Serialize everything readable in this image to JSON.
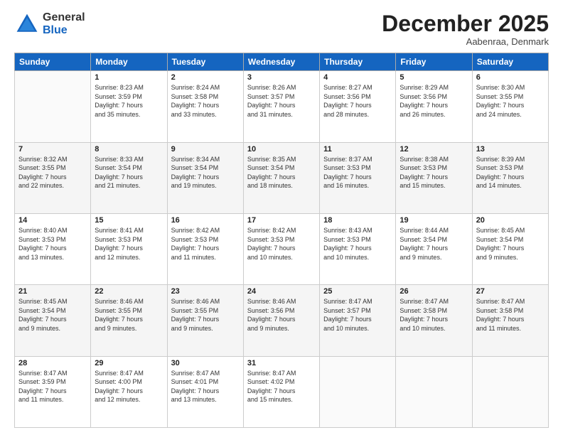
{
  "header": {
    "logo_general": "General",
    "logo_blue": "Blue",
    "month_title": "December 2025",
    "location": "Aabenraa, Denmark"
  },
  "days_of_week": [
    "Sunday",
    "Monday",
    "Tuesday",
    "Wednesday",
    "Thursday",
    "Friday",
    "Saturday"
  ],
  "weeks": [
    [
      {
        "day": "",
        "info": ""
      },
      {
        "day": "1",
        "info": "Sunrise: 8:23 AM\nSunset: 3:59 PM\nDaylight: 7 hours\nand 35 minutes."
      },
      {
        "day": "2",
        "info": "Sunrise: 8:24 AM\nSunset: 3:58 PM\nDaylight: 7 hours\nand 33 minutes."
      },
      {
        "day": "3",
        "info": "Sunrise: 8:26 AM\nSunset: 3:57 PM\nDaylight: 7 hours\nand 31 minutes."
      },
      {
        "day": "4",
        "info": "Sunrise: 8:27 AM\nSunset: 3:56 PM\nDaylight: 7 hours\nand 28 minutes."
      },
      {
        "day": "5",
        "info": "Sunrise: 8:29 AM\nSunset: 3:56 PM\nDaylight: 7 hours\nand 26 minutes."
      },
      {
        "day": "6",
        "info": "Sunrise: 8:30 AM\nSunset: 3:55 PM\nDaylight: 7 hours\nand 24 minutes."
      }
    ],
    [
      {
        "day": "7",
        "info": "Sunrise: 8:32 AM\nSunset: 3:55 PM\nDaylight: 7 hours\nand 22 minutes."
      },
      {
        "day": "8",
        "info": "Sunrise: 8:33 AM\nSunset: 3:54 PM\nDaylight: 7 hours\nand 21 minutes."
      },
      {
        "day": "9",
        "info": "Sunrise: 8:34 AM\nSunset: 3:54 PM\nDaylight: 7 hours\nand 19 minutes."
      },
      {
        "day": "10",
        "info": "Sunrise: 8:35 AM\nSunset: 3:54 PM\nDaylight: 7 hours\nand 18 minutes."
      },
      {
        "day": "11",
        "info": "Sunrise: 8:37 AM\nSunset: 3:53 PM\nDaylight: 7 hours\nand 16 minutes."
      },
      {
        "day": "12",
        "info": "Sunrise: 8:38 AM\nSunset: 3:53 PM\nDaylight: 7 hours\nand 15 minutes."
      },
      {
        "day": "13",
        "info": "Sunrise: 8:39 AM\nSunset: 3:53 PM\nDaylight: 7 hours\nand 14 minutes."
      }
    ],
    [
      {
        "day": "14",
        "info": "Sunrise: 8:40 AM\nSunset: 3:53 PM\nDaylight: 7 hours\nand 13 minutes."
      },
      {
        "day": "15",
        "info": "Sunrise: 8:41 AM\nSunset: 3:53 PM\nDaylight: 7 hours\nand 12 minutes."
      },
      {
        "day": "16",
        "info": "Sunrise: 8:42 AM\nSunset: 3:53 PM\nDaylight: 7 hours\nand 11 minutes."
      },
      {
        "day": "17",
        "info": "Sunrise: 8:42 AM\nSunset: 3:53 PM\nDaylight: 7 hours\nand 10 minutes."
      },
      {
        "day": "18",
        "info": "Sunrise: 8:43 AM\nSunset: 3:53 PM\nDaylight: 7 hours\nand 10 minutes."
      },
      {
        "day": "19",
        "info": "Sunrise: 8:44 AM\nSunset: 3:54 PM\nDaylight: 7 hours\nand 9 minutes."
      },
      {
        "day": "20",
        "info": "Sunrise: 8:45 AM\nSunset: 3:54 PM\nDaylight: 7 hours\nand 9 minutes."
      }
    ],
    [
      {
        "day": "21",
        "info": "Sunrise: 8:45 AM\nSunset: 3:54 PM\nDaylight: 7 hours\nand 9 minutes."
      },
      {
        "day": "22",
        "info": "Sunrise: 8:46 AM\nSunset: 3:55 PM\nDaylight: 7 hours\nand 9 minutes."
      },
      {
        "day": "23",
        "info": "Sunrise: 8:46 AM\nSunset: 3:55 PM\nDaylight: 7 hours\nand 9 minutes."
      },
      {
        "day": "24",
        "info": "Sunrise: 8:46 AM\nSunset: 3:56 PM\nDaylight: 7 hours\nand 9 minutes."
      },
      {
        "day": "25",
        "info": "Sunrise: 8:47 AM\nSunset: 3:57 PM\nDaylight: 7 hours\nand 10 minutes."
      },
      {
        "day": "26",
        "info": "Sunrise: 8:47 AM\nSunset: 3:58 PM\nDaylight: 7 hours\nand 10 minutes."
      },
      {
        "day": "27",
        "info": "Sunrise: 8:47 AM\nSunset: 3:58 PM\nDaylight: 7 hours\nand 11 minutes."
      }
    ],
    [
      {
        "day": "28",
        "info": "Sunrise: 8:47 AM\nSunset: 3:59 PM\nDaylight: 7 hours\nand 11 minutes."
      },
      {
        "day": "29",
        "info": "Sunrise: 8:47 AM\nSunset: 4:00 PM\nDaylight: 7 hours\nand 12 minutes."
      },
      {
        "day": "30",
        "info": "Sunrise: 8:47 AM\nSunset: 4:01 PM\nDaylight: 7 hours\nand 13 minutes."
      },
      {
        "day": "31",
        "info": "Sunrise: 8:47 AM\nSunset: 4:02 PM\nDaylight: 7 hours\nand 15 minutes."
      },
      {
        "day": "",
        "info": ""
      },
      {
        "day": "",
        "info": ""
      },
      {
        "day": "",
        "info": ""
      }
    ]
  ]
}
